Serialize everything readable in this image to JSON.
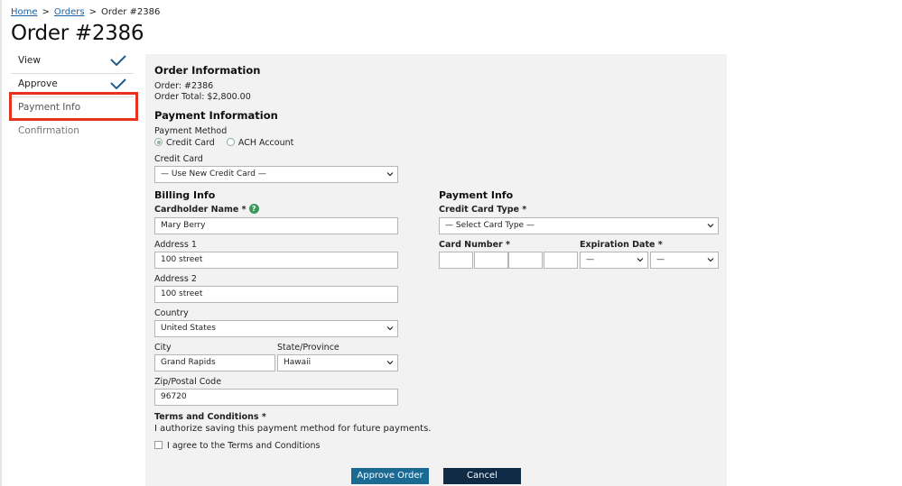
{
  "breadcrumb": {
    "home": "Home",
    "orders": "Orders",
    "current": "Order #2386",
    "sep": ">"
  },
  "page_title": "Order #2386",
  "steps": [
    {
      "label": "View",
      "state": "done"
    },
    {
      "label": "Approve",
      "state": "done"
    },
    {
      "label": "Payment Info",
      "state": "active"
    },
    {
      "label": "Confirmation",
      "state": "future"
    }
  ],
  "order_info": {
    "title": "Order Information",
    "order_line": "Order: #2386",
    "total_line": "Order Total: $2,800.00"
  },
  "payment_information": {
    "title": "Payment Information",
    "method_label": "Payment Method",
    "method_options": [
      "Credit Card",
      "ACH Account"
    ],
    "method_selected": "Credit Card",
    "credit_card_label": "Credit Card",
    "credit_card_value": "— Use New Credit Card —"
  },
  "billing": {
    "title": "Billing Info",
    "cardholder_label": "Cardholder Name *",
    "cardholder_value": "Mary Berry",
    "address1_label": "Address 1",
    "address1_value": "100 street",
    "address2_label": "Address 2",
    "address2_value": "100 street",
    "country_label": "Country",
    "country_value": "United States",
    "city_label": "City",
    "city_value": "Grand Rapids",
    "state_label": "State/Province",
    "state_value": "Hawaii",
    "zip_label": "Zip/Postal Code",
    "zip_value": "96720",
    "terms_title": "Terms and Conditions *",
    "terms_text": "I authorize saving this payment method for future payments.",
    "agree_label": "I agree to the Terms and Conditions",
    "agree_checked": false
  },
  "payment_info": {
    "title": "Payment Info",
    "card_type_label": "Credit Card Type *",
    "card_type_value": "— Select Card Type —",
    "card_number_label": "Card Number *",
    "expiration_label": "Expiration Date *",
    "exp_month_value": "—",
    "exp_year_value": "—"
  },
  "buttons": {
    "approve": "Approve Order",
    "cancel": "Cancel"
  },
  "colors": {
    "link": "#1f5fa0",
    "check": "#1d5c8a",
    "highlight": "#e8321f",
    "primary": "#1a6a93",
    "dark": "#0f2b45",
    "panel": "#f2f2f2",
    "help": "#3b9a5b"
  }
}
